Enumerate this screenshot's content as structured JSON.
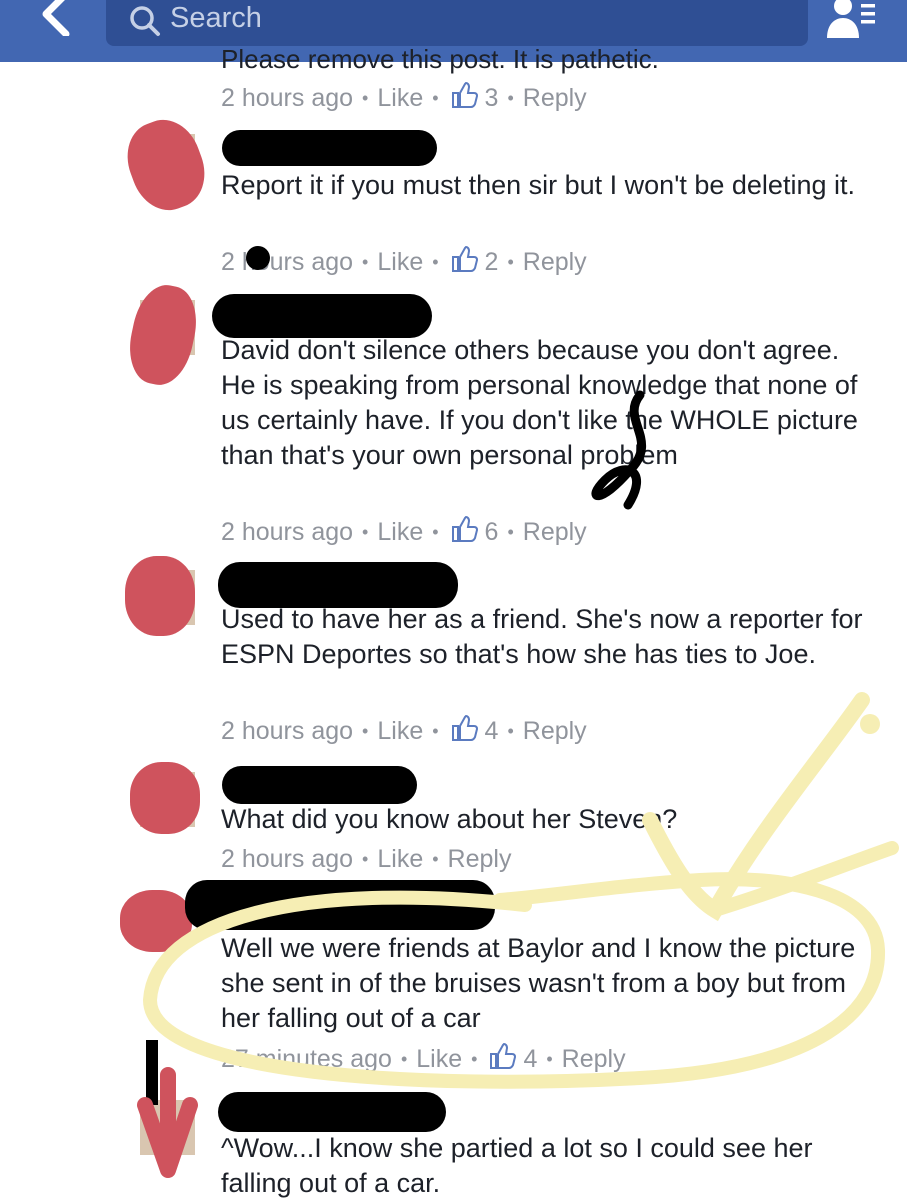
{
  "header": {
    "search_placeholder": "Search",
    "icons": [
      "chevron-left-icon",
      "search-icon",
      "friend-requests-icon"
    ],
    "bar_color": "#4267b2"
  },
  "cut_text": "Please remove this post. It is pathetic.",
  "comments": [
    {
      "text": "",
      "meta": {
        "time": "2 hours ago",
        "like": "Like",
        "count": "3",
        "reply": "Reply"
      }
    },
    {
      "text": "Report it if you must then sir but I won't be deleting it.",
      "meta": {
        "time": "2 hours ago",
        "like": "Like",
        "count": "2",
        "reply": "Reply"
      }
    },
    {
      "text": "David don't silence others because you don't agree. He is speaking from personal knowledge that none of us certainly have. If you don't like the WHOLE picture than that's your own personal problem",
      "meta": {
        "time": "2 hours ago",
        "like": "Like",
        "count": "6",
        "reply": "Reply"
      }
    },
    {
      "text": "Used to have her as a friend. She's now a reporter for ESPN Deportes so that's how she has ties to Joe.",
      "meta": {
        "time": "2 hours ago",
        "like": "Like",
        "count": "4",
        "reply": "Reply"
      }
    },
    {
      "text": "What did you know about her Steven?",
      "meta": {
        "time": "2 hours ago",
        "like": "Like",
        "reply": "Reply"
      }
    },
    {
      "text": "Well we were friends at Baylor and I know the picture she sent in of the bruises wasn't from a boy but from her falling out of a car",
      "meta": {
        "time": "27 minutes ago",
        "like": "Like",
        "count": "4",
        "reply": "Reply"
      }
    },
    {
      "text": "^Wow...I know she partied a lot so I could see her falling out of a car."
    }
  ],
  "colors": {
    "meta_gray": "#90949c",
    "text": "#1d2129",
    "redaction_red": "#cf535d",
    "highlight_yellow": "#f6eeb4"
  }
}
